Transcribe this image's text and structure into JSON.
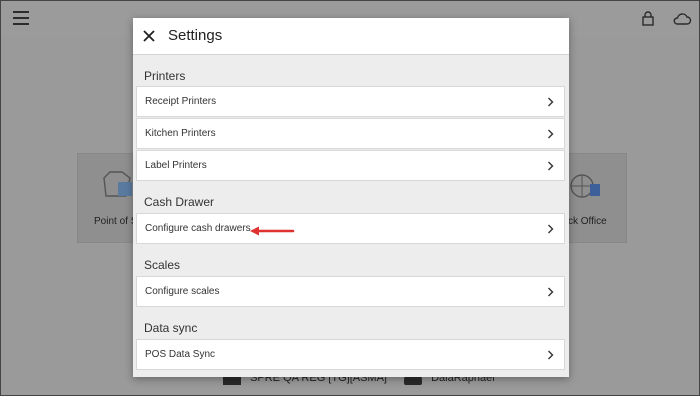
{
  "background": {
    "tiles": [
      {
        "label": "Point of S"
      },
      {
        "label": "ck Office"
      }
    ],
    "footer": {
      "store": "SPRE QA REG [TG][ASMA]",
      "user": "DalaRaphael"
    }
  },
  "modal": {
    "title": "Settings",
    "sections": [
      {
        "title": "Printers",
        "items": [
          {
            "label": "Receipt Printers"
          },
          {
            "label": "Kitchen Printers"
          },
          {
            "label": "Label Printers"
          }
        ]
      },
      {
        "title": "Cash Drawer",
        "items": [
          {
            "label": "Configure cash drawers"
          }
        ]
      },
      {
        "title": "Scales",
        "items": [
          {
            "label": "Configure scales"
          }
        ]
      },
      {
        "title": "Data sync",
        "items": [
          {
            "label": "POS Data Sync"
          }
        ]
      }
    ]
  },
  "colors": {
    "annotation_arrow": "#e03131",
    "overlay": "#9a9a9a",
    "modal_bg": "#ededed"
  },
  "icons": [
    "menu-icon",
    "lock-icon",
    "cloud-icon",
    "close-icon",
    "chevron-right-icon",
    "cart-icon",
    "globe-plug-icon",
    "store-icon",
    "user-icon"
  ]
}
